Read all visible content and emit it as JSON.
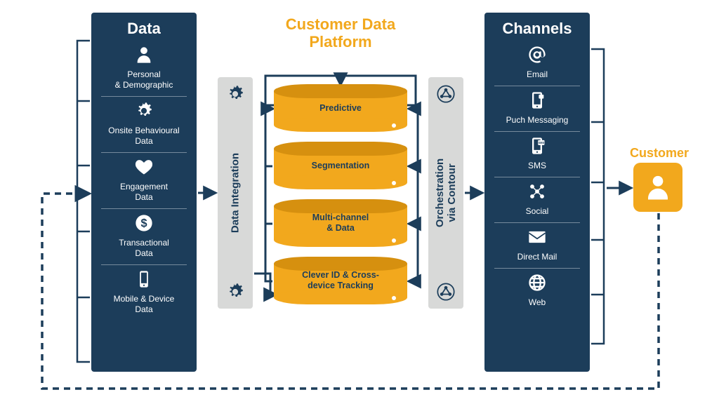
{
  "colors": {
    "navy": "#1c3d5a",
    "amber": "#f2a81d",
    "gray": "#d8d9d8"
  },
  "data_panel": {
    "title": "Data",
    "items": [
      {
        "icon": "person-icon",
        "label": "Personal\n& Demographic"
      },
      {
        "icon": "gears-icon",
        "label": "Onsite Behavioural\nData"
      },
      {
        "icon": "heart-icon",
        "label": "Engagement\nData"
      },
      {
        "icon": "dollar-icon",
        "label": "Transactional\nData"
      },
      {
        "icon": "mobile-icon",
        "label": "Mobile & Device\nData"
      }
    ]
  },
  "integration_bar": {
    "label": "Data Integration",
    "icon_top": "gears-icon",
    "icon_bottom": "gears-icon"
  },
  "cdp": {
    "title": "Customer Data\nPlatform",
    "layers": [
      "Predictive",
      "Segmentation",
      "Multi-channel\n& Data",
      "Clever ID & Cross-\ndevice Tracking"
    ]
  },
  "orchestration_bar": {
    "label_line1": "Orchestration",
    "label_line2": "via Contour",
    "icon_top": "network-icon",
    "icon_bottom": "network-icon"
  },
  "channels_panel": {
    "title": "Channels",
    "items": [
      {
        "icon": "at-icon",
        "label": "Email"
      },
      {
        "icon": "push-icon",
        "label": "Puch Messaging"
      },
      {
        "icon": "sms-icon",
        "label": "SMS"
      },
      {
        "icon": "social-icon",
        "label": "Social"
      },
      {
        "icon": "mail-icon",
        "label": "Direct Mail"
      },
      {
        "icon": "globe-icon",
        "label": "Web"
      }
    ]
  },
  "customer": {
    "label": "Customer",
    "icon": "person-icon"
  }
}
